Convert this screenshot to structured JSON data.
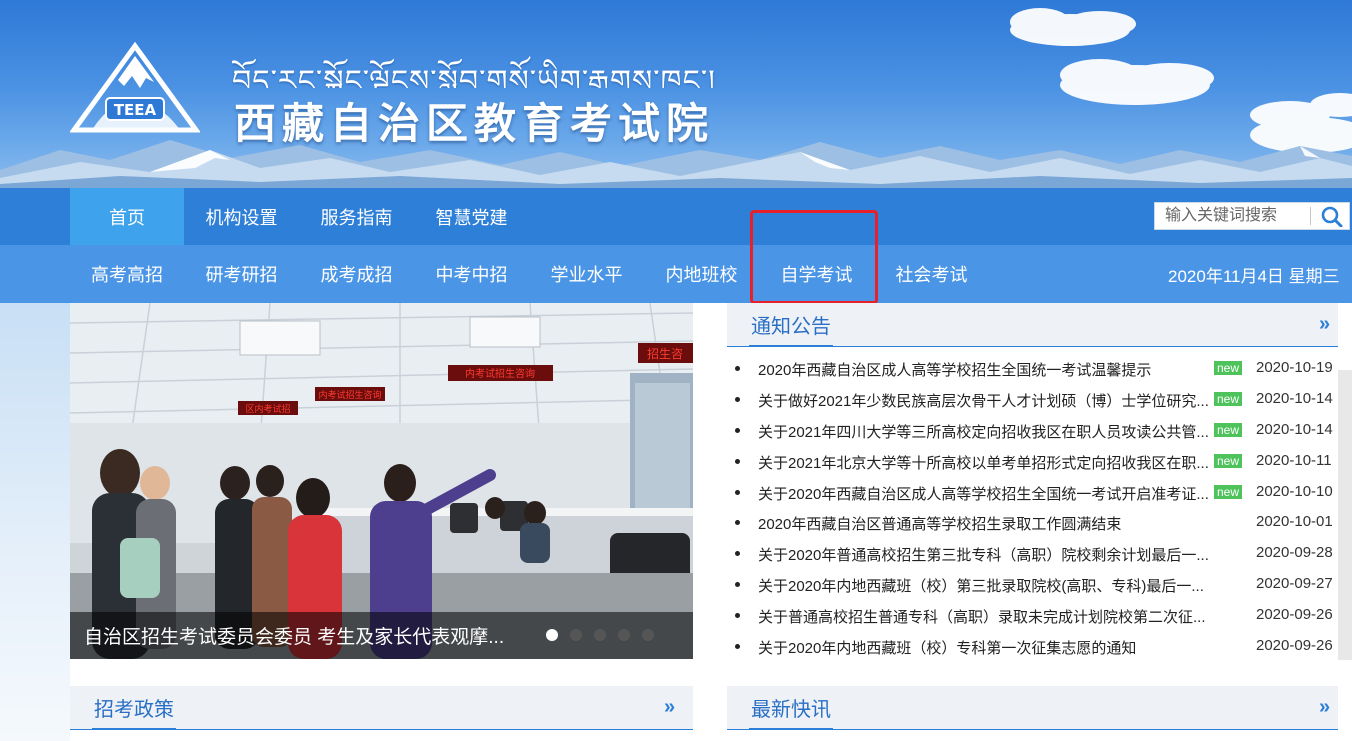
{
  "header": {
    "site_name_tibetan": "བོད་རང་སྐྱོང་ལྗོངས་སློབ་གསོ་ཡིག་རྒྱུགས་ཁང་།",
    "site_name": "西藏自治区教育考试院",
    "logo_text": "TEEA"
  },
  "nav_primary": [
    {
      "label": "首页",
      "active": true
    },
    {
      "label": "机构设置"
    },
    {
      "label": "服务指南"
    },
    {
      "label": "智慧党建"
    }
  ],
  "nav_secondary": [
    {
      "label": "高考高招"
    },
    {
      "label": "研考研招"
    },
    {
      "label": "成考成招"
    },
    {
      "label": "中考中招"
    },
    {
      "label": "学业水平"
    },
    {
      "label": "内地班校"
    },
    {
      "label": "自学考试",
      "highlighted": true
    },
    {
      "label": "社会考试"
    }
  ],
  "search": {
    "placeholder": "输入关键词搜索"
  },
  "date_text": "2020年11月4日 星期三",
  "slideshow": {
    "caption": "自治区招生考试委员会委员 考生及家长代表观摩...",
    "slide_count": 5,
    "current_index": 0,
    "photo_signs": [
      "招生咨",
      "内考试招生咨询",
      "内考试招生咨询",
      "区内考试招"
    ]
  },
  "notices": {
    "title": "通知公告",
    "more": "»",
    "items": [
      {
        "title": "2020年西藏自治区成人高等学校招生全国统一考试温馨提示",
        "new": "new",
        "date": "2020-10-19"
      },
      {
        "title": "关于做好2021年少数民族高层次骨干人才计划硕（博）士学位研究...",
        "new": "new",
        "date": "2020-10-14"
      },
      {
        "title": "关于2021年四川大学等三所高校定向招收我区在职人员攻读公共管...",
        "new": "new",
        "date": "2020-10-14"
      },
      {
        "title": "关于2021年北京大学等十所高校以单考单招形式定向招收我区在职...",
        "new": "new",
        "date": "2020-10-11"
      },
      {
        "title": "关于2020年西藏自治区成人高等学校招生全国统一考试开启准考证...",
        "new": "new",
        "date": "2020-10-10"
      },
      {
        "title": "2020年西藏自治区普通高等学校招生录取工作圆满结束",
        "new": "",
        "date": "2020-10-01"
      },
      {
        "title": "关于2020年普通高校招生第三批专科（高职）院校剩余计划最后一...",
        "new": "",
        "date": "2020-09-28"
      },
      {
        "title": "关于2020年内地西藏班（校）第三批录取院校(高职、专科)最后一...",
        "new": "",
        "date": "2020-09-27"
      },
      {
        "title": "关于普通高校招生普通专科（高职）录取未完成计划院校第二次征...",
        "new": "",
        "date": "2020-09-26"
      },
      {
        "title": "关于2020年内地西藏班（校）专科第一次征集志愿的通知",
        "new": "",
        "date": "2020-09-26"
      }
    ]
  },
  "policy_section": {
    "title": "招考政策",
    "more": "»"
  },
  "news_section": {
    "title": "最新快讯",
    "more": "»"
  },
  "colors": {
    "nav_primary_bg": "#2e7fd8",
    "nav_secondary_bg": "#4a95e6",
    "nav_active_bg": "#3ea3ec",
    "accent": "#2a7fd8",
    "new_badge": "#4ec35b",
    "highlight_box": "#e8202a"
  }
}
